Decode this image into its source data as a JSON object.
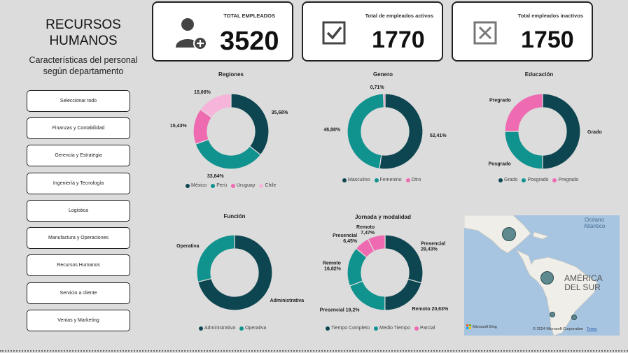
{
  "header": {
    "title": "RECURSOS HUMANOS",
    "subtitle": "Características del personal según departamento"
  },
  "slicers": [
    "Seleccionar todo",
    "Finanzas y Contabilidad",
    "Gerencia y Estrategia",
    "Ingeniería y Tecnología",
    "Logística",
    "Manufactura y Operaciones",
    "Recursos Humanos",
    "Servicio a cliente",
    "Ventas y Marketing"
  ],
  "kpis": {
    "total": {
      "label": "TOTAL EMPLEADOS",
      "value": "3520",
      "icon": "add-user-icon"
    },
    "active": {
      "label": "Total de empleados activos",
      "value": "1770",
      "icon": "checkbox-checked-icon"
    },
    "inactive": {
      "label": "Total empleados inactivos",
      "value": "1750",
      "icon": "checkbox-x-icon"
    }
  },
  "colors": {
    "dark": "#0d4650",
    "teal": "#10928e",
    "pink": "#ef6bb1",
    "lightpink": "#f6b4da"
  },
  "chart_data": [
    {
      "type": "pie",
      "title": "Regiones",
      "categories": [
        "México",
        "Perú",
        "Uruguay",
        "Chile"
      ],
      "values": [
        35.68,
        33.84,
        15.43,
        15.06
      ],
      "labels": [
        "35,68%",
        "33,84%",
        "15,43%",
        "15,06%"
      ],
      "legend": "bottom"
    },
    {
      "type": "pie",
      "title": "Genero",
      "categories": [
        "Masculino",
        "Femenino",
        "Otro"
      ],
      "values": [
        52.41,
        46.88,
        0.71
      ],
      "labels": [
        "52,41%",
        "46,88%",
        "0,71%"
      ],
      "legend": "bottom"
    },
    {
      "type": "pie",
      "title": "Educación",
      "categories": [
        "Grado",
        "Posgrado",
        "Pregrado"
      ],
      "values": [
        50,
        25,
        25
      ],
      "labels": [
        "Grado",
        "Posgrado",
        "Pregrado"
      ],
      "legend": "bottom"
    },
    {
      "type": "pie",
      "title": "Función",
      "categories": [
        "Administrativa",
        "Operativa"
      ],
      "values": [
        71,
        29
      ],
      "labels": [
        "Administrativa",
        "Operativa"
      ],
      "legend": "bottom"
    },
    {
      "type": "pie",
      "title": "Jornada y modalidad",
      "categories": [
        "Tiempo Completo",
        "Medio Tiempo",
        "Parcial"
      ],
      "segments": [
        {
          "label": "Presencial\n29,43%",
          "category": "Tiempo Completo",
          "value": 29.43
        },
        {
          "label": "Remoto 20,63%",
          "category": "Tiempo Completo",
          "value": 20.63
        },
        {
          "label": "Presencial 19,2%",
          "category": "Medio Tiempo",
          "value": 19.2
        },
        {
          "label": "Remoto\n16,82%",
          "category": "Medio Tiempo",
          "value": 16.82
        },
        {
          "label": "Presencial\n6,45%",
          "category": "Parcial",
          "value": 6.45
        },
        {
          "label": "Remoto\n7,47%",
          "category": "Parcial",
          "value": 7.47
        }
      ],
      "legend": "bottom"
    }
  ],
  "map": {
    "labels": {
      "ocean": "Océano Atlántico",
      "continent": "AMÉRICA DEL SUR"
    },
    "attribution": {
      "brand": "Microsoft Bing",
      "copyright": "© 2024 Microsoft Corporation",
      "terms": "Terms"
    }
  }
}
